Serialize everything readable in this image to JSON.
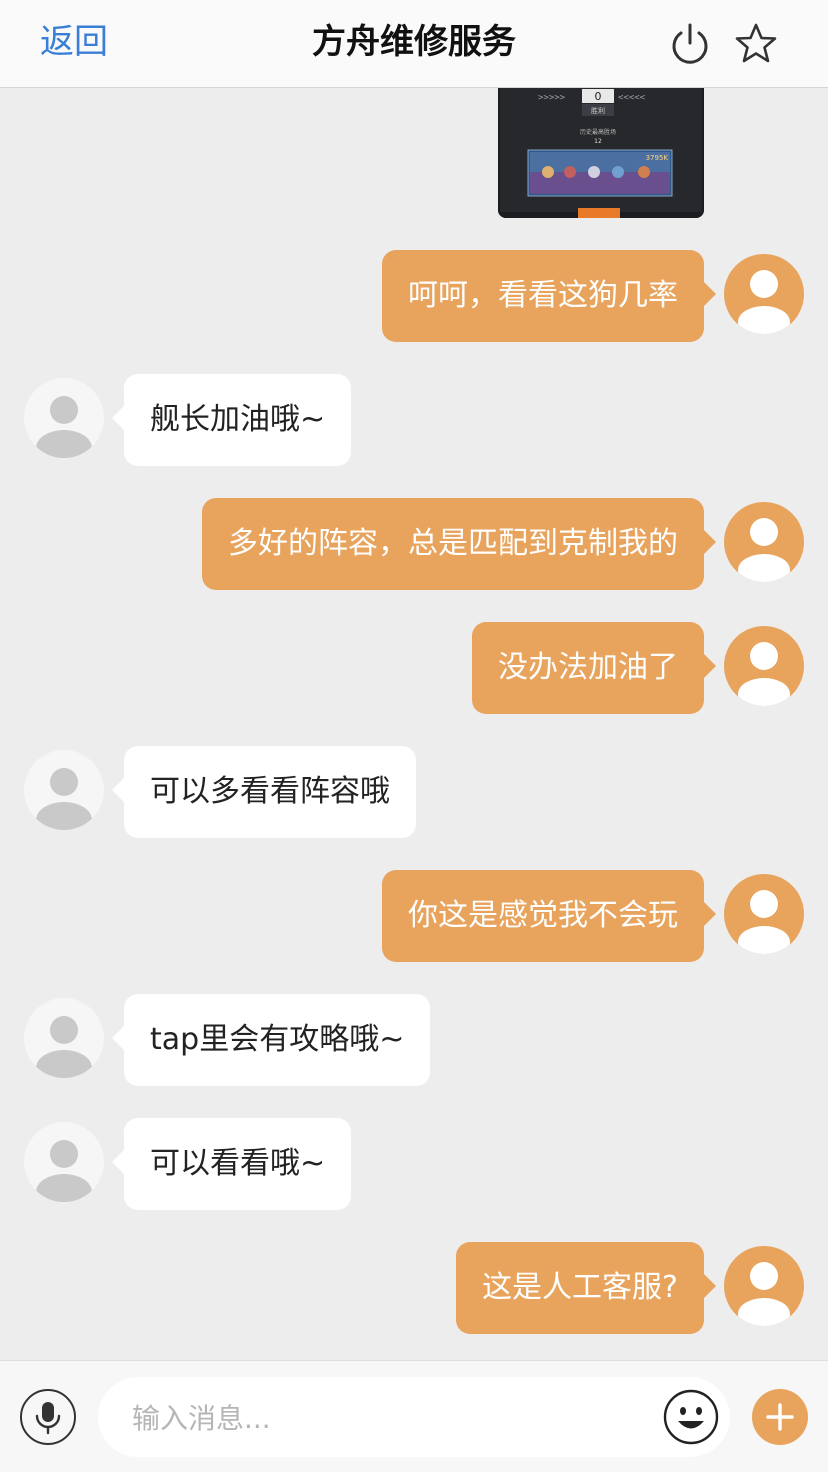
{
  "header": {
    "back_label": "返回",
    "title": "方舟维修服务",
    "icons": [
      "power-icon",
      "star-icon"
    ]
  },
  "screenshot_image": {
    "counter": "0",
    "result_label": "胜利",
    "stat_label": "历史最高胜场",
    "stat_value": "12",
    "score": "3795K"
  },
  "messages": [
    {
      "sender": "me",
      "text": "呵呵，看看这狗几率"
    },
    {
      "sender": "them",
      "text": "舰长加油哦~"
    },
    {
      "sender": "me",
      "text": "多好的阵容，总是匹配到克制我的"
    },
    {
      "sender": "me",
      "text": "没办法加油了"
    },
    {
      "sender": "them",
      "text": "可以多看看阵容哦"
    },
    {
      "sender": "me",
      "text": "你这是感觉我不会玩"
    },
    {
      "sender": "them",
      "text": "tap里会有攻略哦~"
    },
    {
      "sender": "them",
      "text": "可以看看哦~"
    },
    {
      "sender": "me",
      "text": "这是人工客服?"
    }
  ],
  "input": {
    "placeholder": "输入消息..."
  },
  "colors": {
    "accent": "#e8a35c",
    "link": "#3a7fd5",
    "background": "#ededed"
  }
}
